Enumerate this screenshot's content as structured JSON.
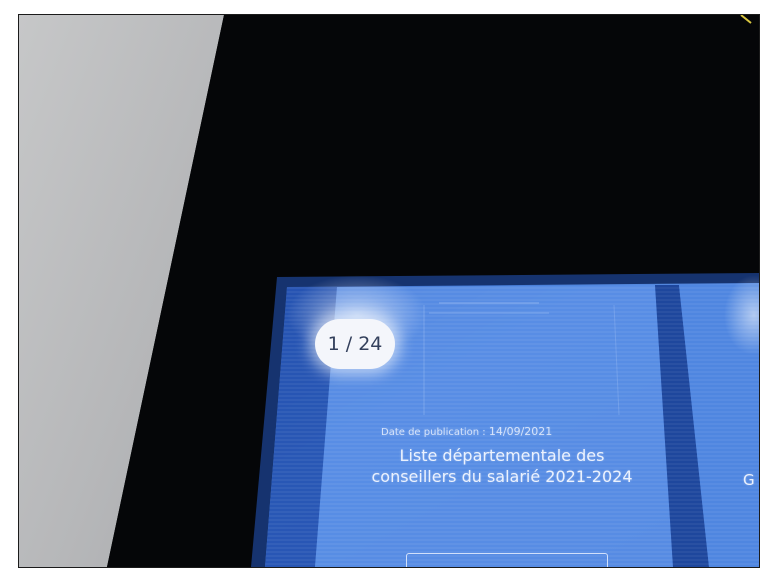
{
  "photo": {
    "subject": "Photo of a public information display screen showing a document listing",
    "colors": {
      "frame": "#050608",
      "wall": "#b9babc",
      "screen_blue": "#3f74d4",
      "panel_dark": "#1f47a0"
    }
  },
  "screen": {
    "page_counter": "1 / 24",
    "publication_prefix": "Date de publication :",
    "publication_date": "14/09/2021",
    "document_title": "Liste départementale des conseillers du salarié 2021-2024",
    "next_card_fragment": "G"
  }
}
